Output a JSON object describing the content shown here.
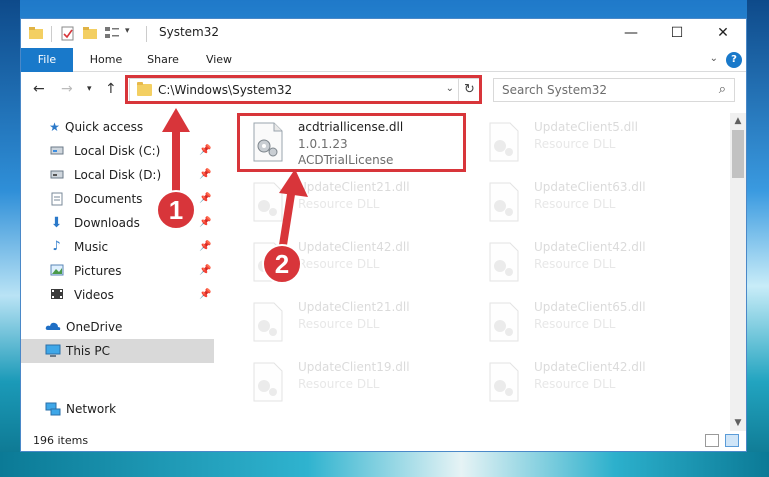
{
  "window": {
    "title": "System32"
  },
  "ribbon": {
    "tabs": [
      "File",
      "Home",
      "Share",
      "View"
    ],
    "help": "?"
  },
  "address": {
    "path": "C:\\Windows\\System32"
  },
  "search": {
    "placeholder": "Search System32"
  },
  "sidebar": {
    "items": [
      {
        "label": "Quick access",
        "icon": "star-icon"
      },
      {
        "label": "Local Disk (C:)",
        "icon": "drive-icon",
        "pinned": true
      },
      {
        "label": "Local Disk (D:)",
        "icon": "drive-icon",
        "pinned": true
      },
      {
        "label": "Documents",
        "icon": "documents-icon",
        "pinned": true
      },
      {
        "label": "Downloads",
        "icon": "download-icon",
        "pinned": true
      },
      {
        "label": "Music",
        "icon": "music-icon",
        "pinned": true
      },
      {
        "label": "Pictures",
        "icon": "pictures-icon",
        "pinned": true
      },
      {
        "label": "Videos",
        "icon": "videos-icon",
        "pinned": true
      },
      {
        "label": "OneDrive",
        "icon": "onedrive-icon"
      },
      {
        "label": "This PC",
        "icon": "computer-icon",
        "selected": true
      },
      {
        "label": "Network",
        "icon": "network-icon"
      }
    ]
  },
  "files": [
    {
      "name": "acdtriallicense.dll",
      "version": "1.0.1.23",
      "desc": "ACDTrialLicense",
      "highlighted": true
    },
    {
      "name": "UpdateClient5.dll",
      "desc": "Resource DLL"
    },
    {
      "name": "UpdateClient21.dll",
      "desc": "Resource DLL"
    },
    {
      "name": "UpdateClient63.dll",
      "desc": "Resource DLL"
    },
    {
      "name": "UpdateClient42.dll",
      "desc": "Resource DLL"
    },
    {
      "name": "UpdateClient42.dll",
      "desc": "Resource DLL"
    },
    {
      "name": "UpdateClient21.dll",
      "desc": "Resource DLL"
    },
    {
      "name": "UpdateClient65.dll",
      "desc": "Resource DLL"
    },
    {
      "name": "UpdateClient19.dll",
      "desc": "Resource DLL"
    },
    {
      "name": "UpdateClient42.dll",
      "desc": "Resource DLL"
    }
  ],
  "status": {
    "item_count": "196 items"
  },
  "annotations": {
    "badge1": "1",
    "badge2": "2",
    "color": "#d8353a"
  },
  "colors": {
    "accent": "#1979ca",
    "folder": "#f3cf62"
  }
}
